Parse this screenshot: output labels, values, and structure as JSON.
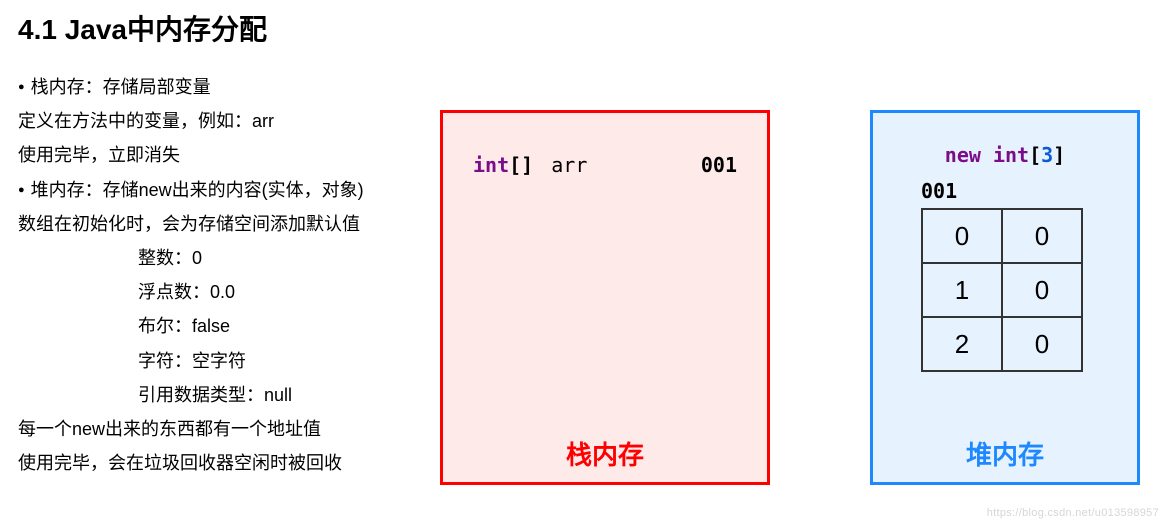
{
  "title": "4.1 Java中内存分配",
  "text": {
    "l1": "栈内存：存储局部变量",
    "l2": "定义在方法中的变量，例如：arr",
    "l3": "使用完毕，立即消失",
    "l4": "堆内存：存储new出来的内容(实体，对象)",
    "l5": "数组在初始化时，会为存储空间添加默认值",
    "d1": "整数：0",
    "d2": "浮点数：0.0",
    "d3": "布尔：false",
    "d4": "字符：空字符",
    "d5": "引用数据类型：null",
    "l6": "每一个new出来的东西都有一个地址值",
    "l7": "使用完毕，会在垃圾回收器空闲时被回收"
  },
  "stack": {
    "kw": "int",
    "brackets": "[]",
    "var": "arr",
    "addr": "001",
    "label": "栈内存"
  },
  "heap": {
    "kw_new": "new",
    "kw_int": "int",
    "size": "3",
    "addr": "001",
    "cells": [
      {
        "idx": "0",
        "val": "0"
      },
      {
        "idx": "1",
        "val": "0"
      },
      {
        "idx": "2",
        "val": "0"
      }
    ],
    "label": "堆内存"
  },
  "watermark": "https://blog.csdn.net/u013598957"
}
